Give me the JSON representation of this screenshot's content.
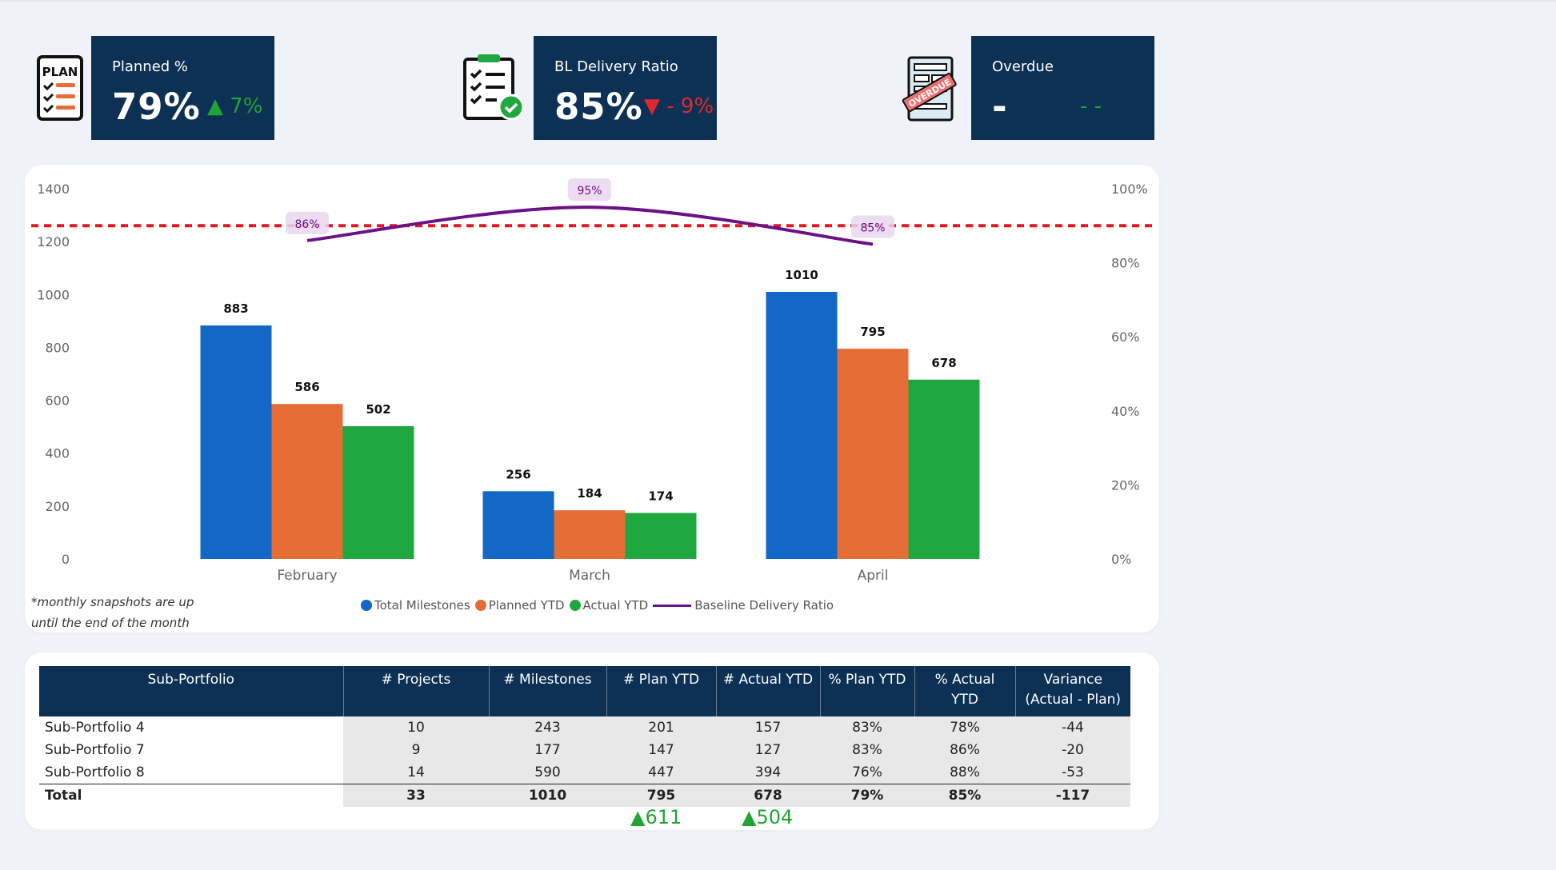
{
  "kpis": {
    "planned": {
      "title": "Planned %",
      "value": "79%",
      "change": "7%",
      "direction": "up"
    },
    "bl_delivery": {
      "title": "BL Delivery Ratio",
      "value": "85%",
      "change": "- 9%",
      "direction": "down"
    },
    "overdue": {
      "title": "Overdue",
      "value": "-",
      "change": "- -",
      "direction": "flat"
    }
  },
  "icons": {
    "plan": "plan-checklist-icon",
    "clipboard": "clipboard-check-icon",
    "overdue": "overdue-document-icon",
    "plan_label": "PLAN",
    "overdue_label": "OVERDUE"
  },
  "colors": {
    "card_bg": "#0d3055",
    "total_milestones": "#1268c4",
    "planned_ytd": "#e56d36",
    "actual_ytd": "#1fa83f",
    "baseline_line": "#6c1287",
    "target_line": "#e8141e",
    "up": "#21a336",
    "down": "#e0282c"
  },
  "chart_data": {
    "type": "bar",
    "categories": [
      "February",
      "March",
      "April"
    ],
    "series": [
      {
        "name": "Total Milestones",
        "values": [
          883,
          256,
          1010
        ]
      },
      {
        "name": "Planned YTD",
        "values": [
          586,
          184,
          795
        ]
      },
      {
        "name": "Actual YTD",
        "values": [
          502,
          174,
          678
        ]
      }
    ],
    "line_series": {
      "name": "Baseline Delivery Ratio",
      "values": [
        86,
        95,
        85
      ],
      "labels": [
        "86%",
        "95%",
        "85%"
      ]
    },
    "target_line": {
      "value": 90
    },
    "ylim": [
      0,
      1400
    ],
    "y2lim": [
      0,
      100
    ],
    "y_ticks": [
      "0",
      "200",
      "400",
      "600",
      "800",
      "1000",
      "1200",
      "1400"
    ],
    "y2_ticks": [
      "0%",
      "20%",
      "40%",
      "60%",
      "80%",
      "100%"
    ],
    "legend_position": "bottom",
    "grid": false
  },
  "chart_note": "*monthly snapshots are up until the end of the month",
  "table": {
    "headers": [
      "Sub-Portfolio",
      "# Projects",
      "# Milestones",
      "# Plan YTD",
      "# Actual YTD",
      "% Plan YTD",
      "% Actual YTD",
      "Variance (Actual - Plan)"
    ],
    "rows": [
      [
        "Sub-Portfolio 4",
        "10",
        "243",
        "201",
        "157",
        "83%",
        "78%",
        "-44"
      ],
      [
        "Sub-Portfolio 7",
        "9",
        "177",
        "147",
        "127",
        "83%",
        "86%",
        "-20"
      ],
      [
        "Sub-Portfolio 8",
        "14",
        "590",
        "447",
        "394",
        "76%",
        "88%",
        "-53"
      ]
    ],
    "total": [
      "Total",
      "33",
      "1010",
      "795",
      "678",
      "79%",
      "85%",
      "-117"
    ],
    "deltas": {
      "plan": "611",
      "actual": "504"
    }
  }
}
